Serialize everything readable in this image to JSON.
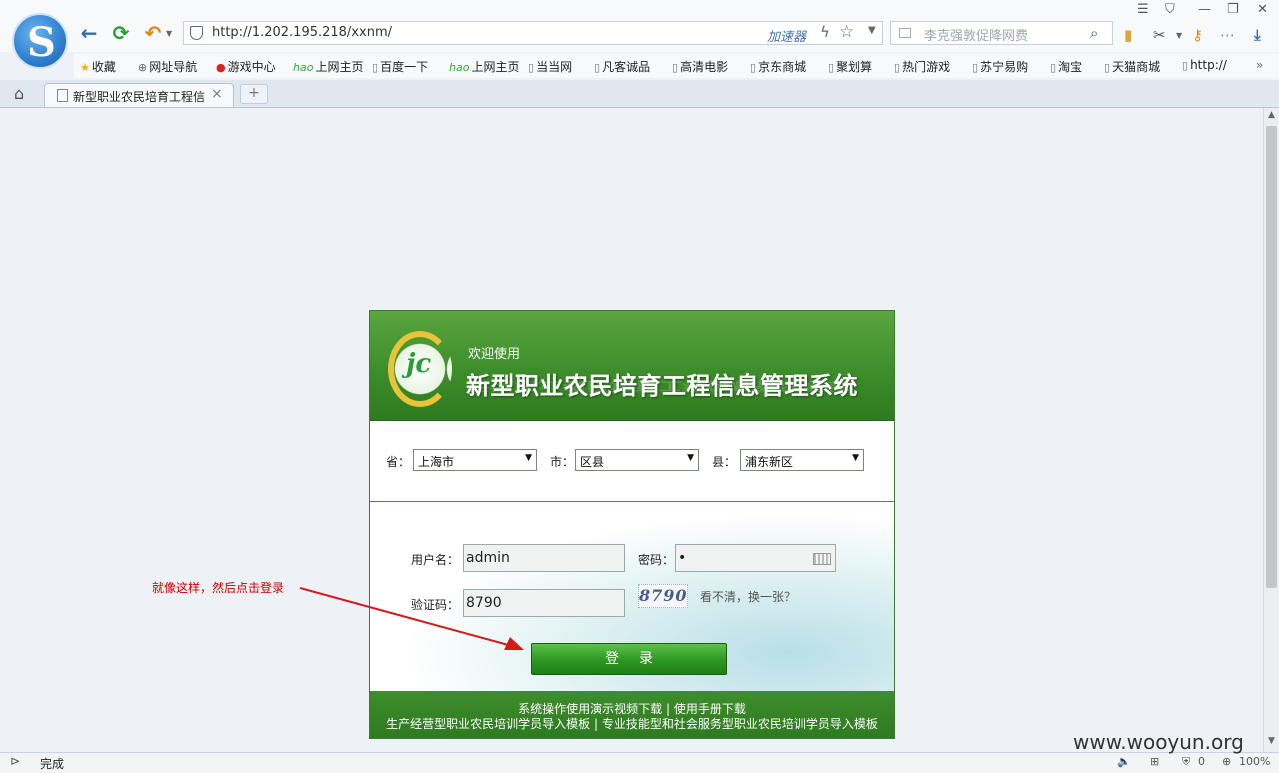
{
  "browser": {
    "address_url": "http://1.202.195.218/xxnm/",
    "accelerator_label": "加速器",
    "search_placeholder": "李克强敦促降网费",
    "bookmarks": [
      "收藏",
      "网址导航",
      "游戏中心",
      "上网主页",
      "百度一下",
      "上网主页",
      "当当网",
      "凡客诚品",
      "高清电影",
      "京东商城",
      "聚划算",
      "热门游戏",
      "苏宁易购",
      "淘宝",
      "天猫商城",
      "http://"
    ],
    "tab_title": "新型职业农民培育工程信",
    "new_tab": "+",
    "status": "完成",
    "zoom": "100%",
    "status_count": "0"
  },
  "login": {
    "welcome": "欢迎使用",
    "system_title": "新型职业农民培育工程信息管理系统",
    "province_label": "省：",
    "province_value": "上海市",
    "city_label": "市：",
    "city_value": "区县",
    "county_label": "县：",
    "county_value": "浦东新区",
    "username_label": "用户名：",
    "username_value": "admin",
    "password_label": "密码：",
    "password_value": "•",
    "captcha_label": "验证码：",
    "captcha_value": "8790",
    "captcha_image_text": "8790",
    "refresh_captcha": "看不清，换一张？",
    "login_button": "登录",
    "footer_line1": "系统操作使用演示视频下载 | 使用手册下载",
    "footer_line2": "生产经营型职业农民培训学员导入模板 | 专业技能型和社会服务型职业农民培训学员导入模板"
  },
  "annotation": "就像这样，然后点击登录",
  "watermark": "www.wooyun.org"
}
